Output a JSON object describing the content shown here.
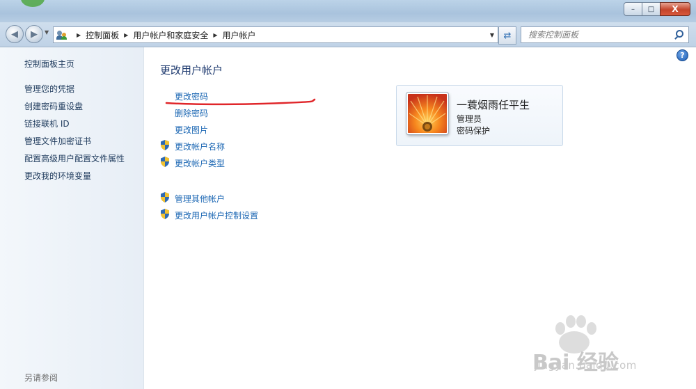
{
  "window": {
    "controls": {
      "minimize": "–",
      "maximize": "□",
      "close": "X"
    }
  },
  "nav": {
    "breadcrumbs": [
      "控制面板",
      "用户帐户和家庭安全",
      "用户帐户"
    ],
    "search_placeholder": "搜索控制面板"
  },
  "sidebar": {
    "home": "控制面板主页",
    "items": [
      "管理您的凭据",
      "创建密码重设盘",
      "链接联机 ID",
      "管理文件加密证书",
      "配置高级用户配置文件属性",
      "更改我的环境变量"
    ],
    "see_also": "另请参阅"
  },
  "main": {
    "title": "更改用户帐户",
    "tasks": [
      "更改密码",
      "删除密码",
      "更改图片"
    ],
    "shield_tasks": [
      "更改帐户名称",
      "更改帐户类型"
    ],
    "other_tasks": [
      "管理其他帐户",
      "更改用户帐户控制设置"
    ],
    "help_label": "?"
  },
  "user": {
    "name": "一蓑烟雨任平生",
    "role": "管理员",
    "status": "密码保护"
  },
  "watermark": {
    "brand": "Bai 经验",
    "url": "jingyan.baidu.com"
  },
  "colors": {
    "link": "#1a66b3",
    "heading": "#1e3a6f",
    "annotation": "#e0262a"
  }
}
